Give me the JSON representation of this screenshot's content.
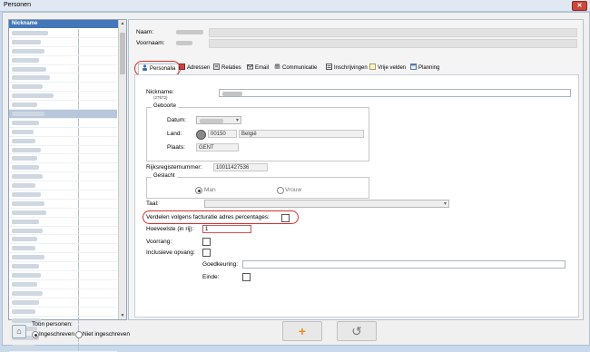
{
  "window": {
    "title": "Personen",
    "close_glyph": "✕"
  },
  "list": {
    "header": "Nickname",
    "row_count": 36,
    "selected_index": 9
  },
  "detail": {
    "naam_label": "Naam:",
    "voornaam_label": "Voornaam:"
  },
  "tabs": [
    {
      "label": "Personalia",
      "icon": "person-icon",
      "active": true
    },
    {
      "label": "Adressen",
      "icon": "address-book-icon"
    },
    {
      "label": "Relaties",
      "icon": "relations-icon"
    },
    {
      "label": "Email",
      "icon": "email-icon"
    },
    {
      "label": "Communicatie",
      "icon": "phone-icon"
    },
    {
      "label": "Inschrijvingen",
      "icon": "registration-icon"
    },
    {
      "label": "Vrije velden",
      "icon": "note-icon"
    },
    {
      "label": "Planning",
      "icon": "calendar-icon"
    }
  ],
  "form": {
    "nickname_label": "Nickname:",
    "nickname_id": "(27572)",
    "geboorte_label": "Geboorte",
    "datum_label": "Datum:",
    "land_label": "Land:",
    "land_code": "00150",
    "land_name": "België",
    "plaats_label": "Plaats:",
    "plaats_value": "GENT",
    "rijksregister_label": "Rijksregisternummer:",
    "rijksregister_value": "10011427536",
    "geslacht_label": "Geslacht",
    "man_label": "Man",
    "vrouw_label": "Vrouw",
    "taal_label": "Taal:",
    "verdelen_label": "Verdelen volgens facturatie adres percentages:",
    "hoeveelste_label": "Hoeveelste (in rij):",
    "hoeveelste_value": "1",
    "voorrang_label": "Voorrang:",
    "inclusieve_label": "Inclusieve opvang:",
    "goedkeuring_label": "Goedkeuring:",
    "einde_label": "Einde:"
  },
  "footer": {
    "toon_label": "Toon personen:",
    "ingeschreven_label": "Ingeschreven",
    "niet_ingeschreven_label": "Niet ingeschreven",
    "add_glyph": "+",
    "undo_glyph": "↺"
  },
  "colors": {
    "accent": "#4477b8",
    "highlight_oval": "#d43030",
    "add_orange": "#f08a1c"
  }
}
